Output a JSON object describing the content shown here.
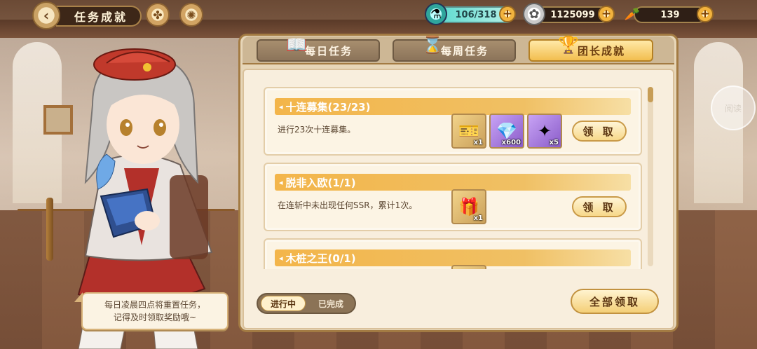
{
  "header": {
    "title": "任务成就",
    "back_icon": "back-arrow-icon",
    "badges": [
      "clover-icon",
      "compass-icon",
      "book-icon"
    ]
  },
  "resources": [
    {
      "name": "energy",
      "icon": "potion-icon",
      "value": "106/318"
    },
    {
      "name": "coins",
      "icon": "coin-icon",
      "value": "1125099"
    },
    {
      "name": "carrots",
      "icon": "carrot-icon",
      "value": "139"
    }
  ],
  "tabs": [
    {
      "label": "每日任务",
      "icon": "notebook-icon",
      "active": false
    },
    {
      "label": "每周任务",
      "icon": "hourglass-icon",
      "active": false
    },
    {
      "label": "团长成就",
      "icon": "trophy-icon",
      "active": true
    }
  ],
  "tasks": [
    {
      "title": "十连募集(23/23)",
      "description": "进行23次十连募集。",
      "claim_label": "领 取",
      "rewards": [
        {
          "icon": "ticket-icon",
          "qty": "x1"
        },
        {
          "icon": "purple-crystal-icon",
          "qty": "x600"
        },
        {
          "icon": "rainbow-crystal-icon",
          "qty": "x5"
        }
      ]
    },
    {
      "title": "脱非入欧(1/1)",
      "description": "在连斩中未出现任何SSR，累计1次。",
      "claim_label": "领 取",
      "rewards": [
        {
          "icon": "gift-box-icon",
          "qty": "x1"
        }
      ]
    },
    {
      "title": "木桩之王(0/1)",
      "description": "",
      "claim_label": "",
      "rewards": [
        {
          "icon": "reward-icon",
          "qty": ""
        }
      ]
    }
  ],
  "filters": [
    {
      "label": "进行中",
      "active": true
    },
    {
      "label": "已完成",
      "active": false
    }
  ],
  "claim_all_label": "全部领取",
  "speech": "每日凌晨四点将重置任务，\n记得及时领取奖励哦~",
  "float_button_label": "阅读",
  "colors": {
    "accent": "#f2be4f",
    "panel": "#f8eedd",
    "border": "#a37b43"
  }
}
